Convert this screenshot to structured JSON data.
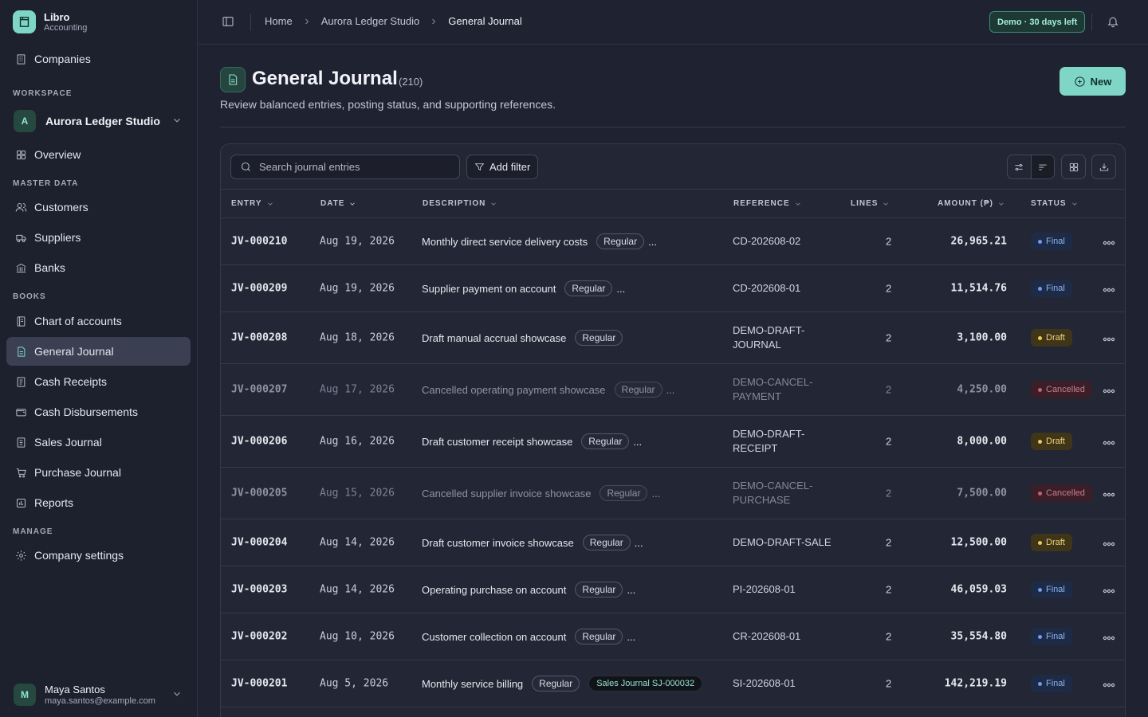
{
  "brand": {
    "name": "Libro",
    "sub": "Accounting"
  },
  "nav": {
    "companies": "Companies",
    "workspace_label": "WORKSPACE",
    "workspace_avatar": "A",
    "workspace_name": "Aurora Ledger Studio",
    "overview": "Overview",
    "master_label": "MASTER DATA",
    "customers": "Customers",
    "suppliers": "Suppliers",
    "banks": "Banks",
    "books_label": "BOOKS",
    "chart_of_accounts": "Chart of accounts",
    "general_journal": "General Journal",
    "cash_receipts": "Cash Receipts",
    "cash_disbursements": "Cash Disbursements",
    "sales_journal": "Sales Journal",
    "purchase_journal": "Purchase Journal",
    "reports": "Reports",
    "manage_label": "MANAGE",
    "company_settings": "Company settings"
  },
  "user": {
    "avatar": "M",
    "name": "Maya Santos",
    "email": "maya.santos@example.com"
  },
  "breadcrumb": {
    "home": "Home",
    "company": "Aurora Ledger Studio",
    "current": "General Journal"
  },
  "demo_badge": "Demo · 30 days left",
  "header": {
    "title": "General Journal",
    "count": "(210)",
    "subtitle": "Review balanced entries, posting status, and supporting references.",
    "new_label": "New"
  },
  "toolbar": {
    "search_placeholder": "Search journal entries",
    "filter_label": "Add filter"
  },
  "columns": {
    "entry": "ENTRY",
    "date": "DATE",
    "description": "DESCRIPTION",
    "reference": "REFERENCE",
    "lines": "LINES",
    "amount": "AMOUNT (₱)",
    "status": "STATUS"
  },
  "rows": [
    {
      "entry": "JV-000210",
      "date": "Aug 19, 2026",
      "desc": "Monthly direct service delivery costs",
      "tag": "Regular",
      "more": "...",
      "link": "",
      "ref": "CD-202608-02",
      "lines": "2",
      "amount": "26,965.21",
      "status": "Final"
    },
    {
      "entry": "JV-000209",
      "date": "Aug 19, 2026",
      "desc": "Supplier payment on account",
      "tag": "Regular",
      "more": "...",
      "link": "",
      "ref": "CD-202608-01",
      "lines": "2",
      "amount": "11,514.76",
      "status": "Final"
    },
    {
      "entry": "JV-000208",
      "date": "Aug 18, 2026",
      "desc": "Draft manual accrual showcase",
      "tag": "Regular",
      "more": "",
      "link": "",
      "ref": "DEMO-DRAFT-JOURNAL",
      "lines": "2",
      "amount": "3,100.00",
      "status": "Draft"
    },
    {
      "entry": "JV-000207",
      "date": "Aug 17, 2026",
      "desc": "Cancelled operating payment showcase",
      "tag": "Regular",
      "more": "...",
      "link": "",
      "ref": "DEMO-CANCEL-PAYMENT",
      "lines": "2",
      "amount": "4,250.00",
      "status": "Cancelled"
    },
    {
      "entry": "JV-000206",
      "date": "Aug 16, 2026",
      "desc": "Draft customer receipt showcase",
      "tag": "Regular",
      "more": "...",
      "link": "",
      "ref": "DEMO-DRAFT-RECEIPT",
      "lines": "2",
      "amount": "8,000.00",
      "status": "Draft"
    },
    {
      "entry": "JV-000205",
      "date": "Aug 15, 2026",
      "desc": "Cancelled supplier invoice showcase",
      "tag": "Regular",
      "more": "...",
      "link": "",
      "ref": "DEMO-CANCEL-PURCHASE",
      "lines": "2",
      "amount": "7,500.00",
      "status": "Cancelled"
    },
    {
      "entry": "JV-000204",
      "date": "Aug 14, 2026",
      "desc": "Draft customer invoice showcase",
      "tag": "Regular",
      "more": "...",
      "link": "",
      "ref": "DEMO-DRAFT-SALE",
      "lines": "2",
      "amount": "12,500.00",
      "status": "Draft"
    },
    {
      "entry": "JV-000203",
      "date": "Aug 14, 2026",
      "desc": "Operating purchase on account",
      "tag": "Regular",
      "more": "...",
      "link": "",
      "ref": "PI-202608-01",
      "lines": "2",
      "amount": "46,059.03",
      "status": "Final"
    },
    {
      "entry": "JV-000202",
      "date": "Aug 10, 2026",
      "desc": "Customer collection on account",
      "tag": "Regular",
      "more": "...",
      "link": "",
      "ref": "CR-202608-01",
      "lines": "2",
      "amount": "35,554.80",
      "status": "Final"
    },
    {
      "entry": "JV-000201",
      "date": "Aug 5, 2026",
      "desc": "Monthly service billing",
      "tag": "Regular",
      "more": "",
      "link": "Sales Journal SJ-000032",
      "ref": "SI-202608-01",
      "lines": "2",
      "amount": "142,219.19",
      "status": "Final"
    }
  ],
  "colors": {
    "accent": "#7fd6c6",
    "final": "#6d9cf0",
    "draft": "#f0c955",
    "cancelled": "#cc5d74"
  }
}
